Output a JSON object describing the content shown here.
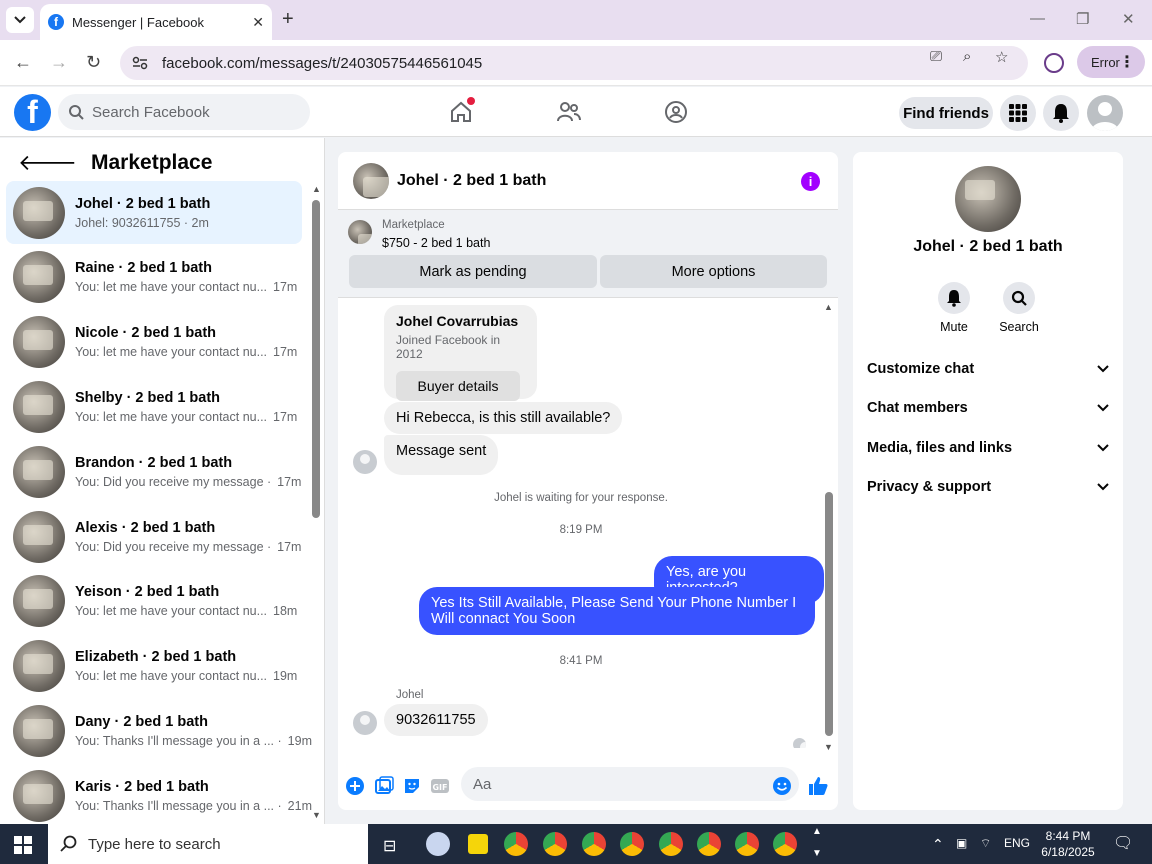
{
  "browser": {
    "tab_title": "Messenger | Facebook",
    "url": "facebook.com/messages/t/24030575446561045",
    "profile_button_label": "Error"
  },
  "fb_header": {
    "search_placeholder": "Search Facebook",
    "find_friends_label": "Find friends"
  },
  "sidebar": {
    "title": "Marketplace",
    "conversations": [
      {
        "name": "Johel · 2 bed 1 bath",
        "snippet": "Johel: 9032611755 · 2m",
        "time": ""
      },
      {
        "name": "Raine · 2 bed 1 bath",
        "snippet": "You: let me have your contact nu...",
        "time": "17m"
      },
      {
        "name": "Nicole · 2 bed 1 bath",
        "snippet": "You: let me have your contact nu...",
        "time": "17m"
      },
      {
        "name": "Shelby · 2 bed 1 bath",
        "snippet": "You: let me have your contact nu...",
        "time": "17m"
      },
      {
        "name": "Brandon · 2 bed 1 bath",
        "snippet": "You: Did you receive my message ·",
        "time": "17m"
      },
      {
        "name": "Alexis · 2 bed 1 bath",
        "snippet": "You: Did you receive my message ·",
        "time": "17m"
      },
      {
        "name": "Yeison · 2 bed 1 bath",
        "snippet": "You: let me have your contact nu...",
        "time": "18m"
      },
      {
        "name": "Elizabeth · 2 bed 1 bath",
        "snippet": "You: let me have your contact nu...",
        "time": "19m"
      },
      {
        "name": "Dany · 2 bed 1 bath",
        "snippet": "You: Thanks I'll message you in a ... ·",
        "time": "19m"
      },
      {
        "name": "Karis · 2 bed 1 bath",
        "snippet": "You: Thanks I'll message you in a ... ·",
        "time": "21m"
      }
    ]
  },
  "chat": {
    "title": "Johel · 2 bed 1 bath",
    "marketplace_label": "Marketplace",
    "listing": "$750 - 2 bed 1 bath",
    "mark_pending_label": "Mark as pending",
    "more_options_label": "More options",
    "buyer_name": "Johel Covarrubias",
    "buyer_joined": "Joined Facebook in 2012",
    "buyer_details_label": "Buyer details",
    "msg_1": "Hi Rebecca, is this still available?",
    "msg_2": "Message sent",
    "waiting_note": "Johel is waiting for your response.",
    "time_1": "8:19 PM",
    "msg_3": "Yes, are you interested?",
    "msg_4": "Yes Its Still Available, Please Send Your Phone Number I Will connact You Soon",
    "time_2": "8:41 PM",
    "sender_label": "Johel",
    "msg_5": "9032611755",
    "composer_placeholder": "Aa"
  },
  "details": {
    "name": "Johel · 2 bed 1 bath",
    "mute_label": "Mute",
    "search_label": "Search",
    "sections": [
      "Customize chat",
      "Chat members",
      "Media, files and links",
      "Privacy & support"
    ]
  },
  "taskbar": {
    "search_placeholder": "Type here to search",
    "language": "ENG",
    "time": "8:44 PM",
    "date": "6/18/2025"
  },
  "colors": {
    "fb_blue": "#1877f2",
    "outgoing_bubble": "#3852ff",
    "info_purple": "#a200ff",
    "active_item": "#e7f3ff"
  }
}
